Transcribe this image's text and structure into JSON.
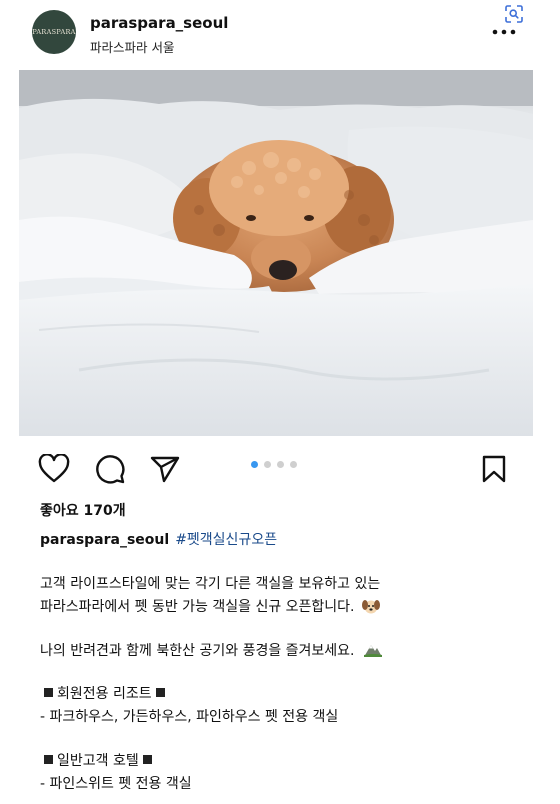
{
  "header": {
    "avatar_text": "PARASPARA",
    "username": "paraspara_seoul",
    "location": "파라스파라 서울"
  },
  "post": {
    "image_alt": "dog-on-bed-photo",
    "carousel_dots": 4,
    "carousel_active": 1
  },
  "actions": {
    "like_icon": "heart-icon",
    "comment_icon": "comment-icon",
    "share_icon": "send-icon",
    "save_icon": "bookmark-icon"
  },
  "likes": "좋아요 170개",
  "caption": {
    "username": "paraspara_seoul",
    "hashtag": "#펫객실신규오픈",
    "line1": "고객 라이프스타일에 맞는 각기 다른 객실을 보유하고 있는",
    "line2": "파라스파라에서 펫 동반 가능 객실을 신규 오픈합니다.",
    "line3": "나의 반려견과 함께 북한산 공기와 풍경을 즐겨보세요.",
    "section1_title": "회원전용 리조트",
    "section1_body": "- 파크하우스, 가든하우스, 파인하우스 펫 전용 객실",
    "section2_title": "일반고객 호텔",
    "section2_body": "- 파인스위트 펫 전용 객실"
  },
  "colors": {
    "avatar_bg": "#32473d",
    "hashtag": "#1a4a8a",
    "dot_active": "#3897f0"
  }
}
